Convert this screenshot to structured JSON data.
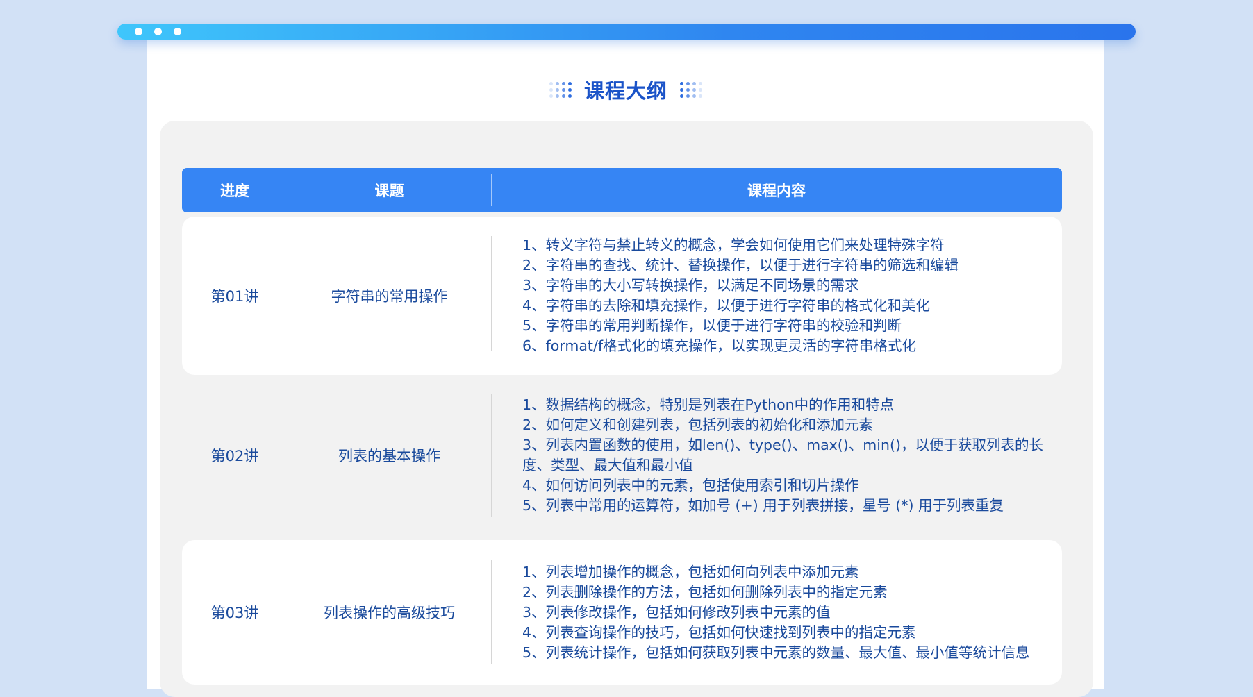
{
  "window": {
    "title": "课程大纲"
  },
  "table": {
    "headers": {
      "progress": "进度",
      "topic": "课题",
      "content": "课程内容"
    },
    "rows": [
      {
        "progress": "第01讲",
        "topic": "字符串的常用操作",
        "lines": [
          "1、转义字符与禁止转义的概念，学会如何使用它们来处理特殊字符",
          "2、字符串的查找、统计、替换操作，以便于进行字符串的筛选和编辑",
          "3、字符串的大小写转换操作，以满足不同场景的需求",
          "4、字符串的去除和填充操作，以便于进行字符串的格式化和美化",
          "5、字符串的常用判断操作，以便于进行字符串的校验和判断",
          "6、format/f格式化的填充操作，以实现更灵活的字符串格式化"
        ]
      },
      {
        "progress": "第02讲",
        "topic": "列表的基本操作",
        "lines": [
          "1、数据结构的概念，特别是列表在Python中的作用和特点",
          "2、如何定义和创建列表，包括列表的初始化和添加元素",
          "3、列表内置函数的使用，如len()、type()、max()、min()，以便于获取列表的长",
          "度、类型、最大值和最小值",
          "4、如何访问列表中的元素，包括使用索引和切片操作",
          "5、列表中常用的运算符，如加号 (+) 用于列表拼接，星号 (*) 用于列表重复"
        ]
      },
      {
        "progress": "第03讲",
        "topic": "列表操作的高级技巧",
        "lines": [
          "1、列表增加操作的概念，包括如何向列表中添加元素",
          "2、列表删除操作的方法，包括如何删除列表中的指定元素",
          "3、列表修改操作，包括如何修改列表中元素的值",
          "4、列表查询操作的技巧，包括如何快速找到列表中的指定元素",
          "5、列表统计操作，包括如何获取列表中元素的数量、最大值、最小值等统计信息"
        ]
      }
    ]
  },
  "colors": {
    "page_background": "#d2e1f6",
    "accent": "#3685f4",
    "title_text": "#1a53c8",
    "body_text": "#1a4a9c",
    "panel": "#f2f2f2"
  }
}
